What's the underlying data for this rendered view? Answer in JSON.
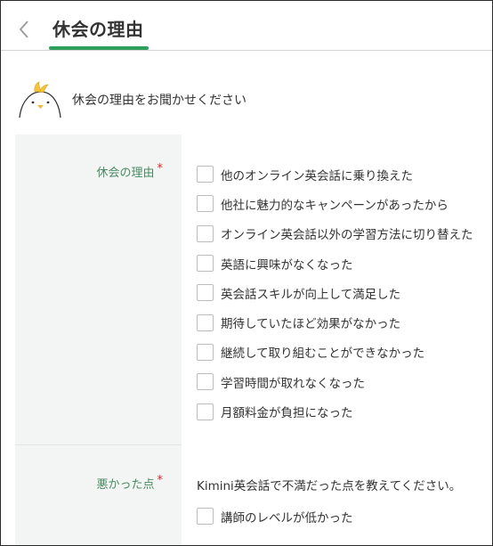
{
  "header": {
    "title": "休会の理由"
  },
  "intro": {
    "text": "休会の理由をお聞かせください",
    "mascot_icon": "chick-mascot-icon"
  },
  "fields": {
    "reason": {
      "label": "休会の理由",
      "required_mark": "*",
      "options": [
        "他のオンライン英会話に乗り換えた",
        "他社に魅力的なキャンペーンがあったから",
        "オンライン英会話以外の学習方法に切り替えた",
        "英語に興味がなくなった",
        "英会話スキルが向上して満足した",
        "期待していたほど効果がなかった",
        "継続して取り組むことができなかった",
        "学習時間が取れなくなった",
        "月額料金が負担になった"
      ]
    },
    "bad_points": {
      "label": "悪かった点",
      "required_mark": "*",
      "description": "Kimini英会話で不満だった点を教えてください。",
      "options": [
        "講師のレベルが低かった"
      ]
    }
  },
  "colors": {
    "accent": "#2e9e5b",
    "label_text": "#4a8a62",
    "label_bg": "#f2f5f3",
    "required": "#e02424"
  }
}
